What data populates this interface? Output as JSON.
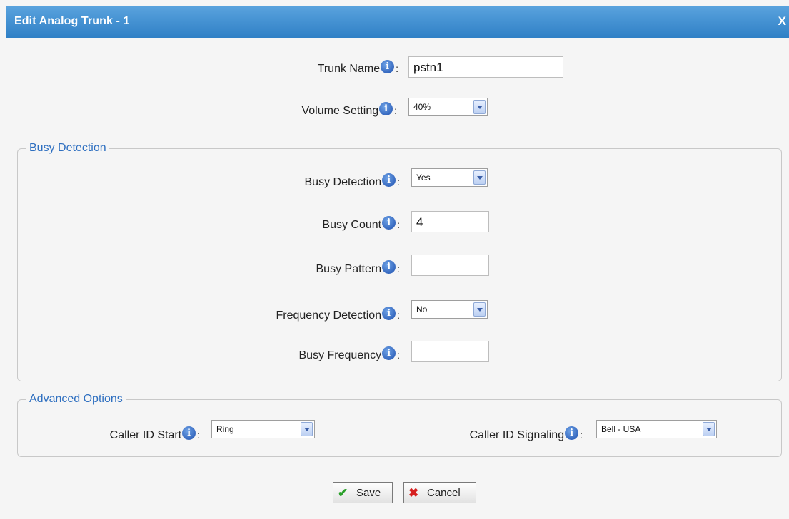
{
  "dialog": {
    "title": "Edit Analog Trunk - 1",
    "close_label": "X"
  },
  "general": {
    "trunk_name": {
      "label": "Trunk Name",
      "value": "pstn1"
    },
    "volume_setting": {
      "label": "Volume Setting",
      "value": "40%"
    }
  },
  "busy_detection": {
    "legend": "Busy Detection",
    "busy_detection": {
      "label": "Busy Detection",
      "value": "Yes"
    },
    "busy_count": {
      "label": "Busy Count",
      "value": "4"
    },
    "busy_pattern": {
      "label": "Busy Pattern",
      "value": ""
    },
    "frequency_detection": {
      "label": "Frequency Detection",
      "value": "No"
    },
    "busy_frequency": {
      "label": "Busy Frequency",
      "value": ""
    }
  },
  "advanced": {
    "legend": "Advanced Options",
    "caller_id_start": {
      "label": "Caller ID Start",
      "value": "Ring"
    },
    "caller_id_signaling": {
      "label": "Caller ID Signaling",
      "value": "Bell - USA"
    }
  },
  "buttons": {
    "save": "Save",
    "cancel": "Cancel"
  },
  "common": {
    "info_glyph": "i",
    "colon": ":"
  },
  "colors": {
    "title_bar": "#3d8fd4",
    "legend": "#2e6fc0",
    "save_icon": "#2aa02a",
    "cancel_icon": "#d62020"
  },
  "icons": {
    "info": "info-icon",
    "save": "checkmark-icon",
    "cancel": "x-icon",
    "dropdown": "chevron-down-icon"
  }
}
